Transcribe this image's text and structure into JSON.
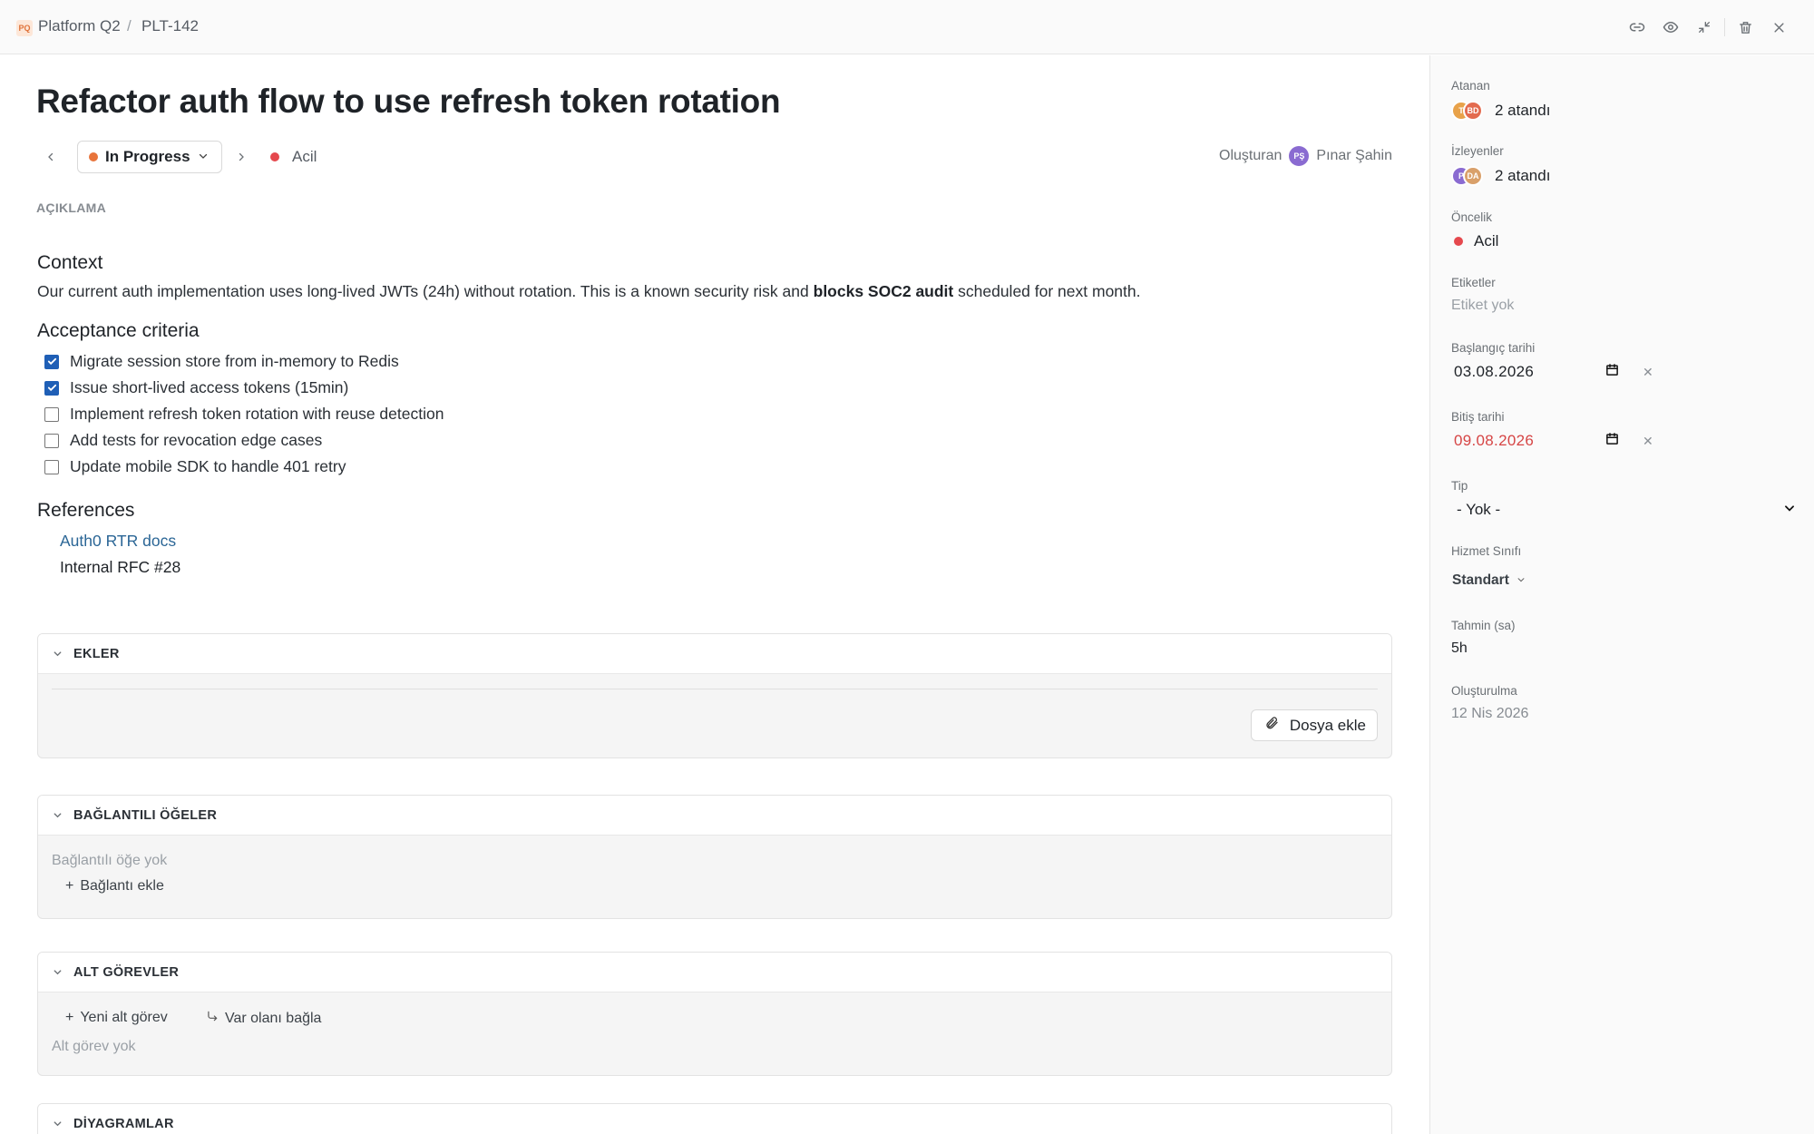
{
  "breadcrumb": {
    "project_badge": "PQ",
    "project": "Platform Q2",
    "separator": "/",
    "issue_key": "PLT-142"
  },
  "toolbar_icons": [
    "link-icon",
    "eye-icon",
    "collapse-icon",
    "trash-icon",
    "close-icon"
  ],
  "issue": {
    "title": "Refactor auth flow to use refresh token rotation",
    "status": "In Progress",
    "status_color": "#e8743b",
    "priority": "Acil",
    "priority_color": "#e5484d",
    "created_by_label": "Oluşturan",
    "creator_initials": "PŞ",
    "creator_name": "Pınar Şahin",
    "creator_color": "#8a6bd1"
  },
  "description": {
    "label": "AÇIKLAMA",
    "context_heading": "Context",
    "context_text_1": "Our current auth implementation uses long-lived JWTs (24h) without rotation. This is a known security risk and",
    "context_bold": "blocks SOC2 audit",
    "context_text_2": "scheduled for next month.",
    "criteria_heading": "Acceptance criteria",
    "criteria": [
      {
        "text": "Migrate session store from in-memory to Redis",
        "checked": true
      },
      {
        "text": "Issue short-lived access tokens (15min)",
        "checked": true
      },
      {
        "text": "Implement refresh token rotation with reuse detection",
        "checked": false
      },
      {
        "text": "Add tests for revocation edge cases",
        "checked": false
      },
      {
        "text": "Update mobile SDK to handle 401 retry",
        "checked": false
      }
    ],
    "references_heading": "References",
    "references": [
      {
        "text": "Auth0 RTR docs",
        "link": true
      },
      {
        "text": "Internal RFC #28",
        "link": false
      }
    ]
  },
  "attachments": {
    "title": "EKLER",
    "add_button": "Dosya ekle"
  },
  "linked_items": {
    "title": "BAĞLANTILI ÖĞELER",
    "empty": "Bağlantılı öğe yok",
    "add": "Bağlantı ekle"
  },
  "subtasks": {
    "title": "ALT GÖREVLER",
    "new": "Yeni alt görev",
    "link_existing": "Var olanı bağla",
    "empty": "Alt görev yok"
  },
  "diagrams": {
    "title": "DİYAGRAMLAR"
  },
  "sidebar": {
    "assignees": {
      "label": "Atanan",
      "value": "2 atandı",
      "avatars": [
        {
          "initials": "T",
          "color": "#e8a24a"
        },
        {
          "initials": "BD",
          "color": "#e36b4f"
        }
      ]
    },
    "watchers": {
      "label": "İzleyenler",
      "value": "2 atandı",
      "avatars": [
        {
          "initials": "P",
          "color": "#8a6bd1"
        },
        {
          "initials": "DA",
          "color": "#d9a06a"
        }
      ]
    },
    "priority": {
      "label": "Öncelik",
      "value": "Acil",
      "color": "#e5484d"
    },
    "labels": {
      "label": "Etiketler",
      "value": "Etiket yok"
    },
    "start_date": {
      "label": "Başlangıç tarihi",
      "value": "03.08.2026"
    },
    "due_date": {
      "label": "Bitiş tarihi",
      "value": "09.08.2026",
      "color": "#d64545"
    },
    "type": {
      "label": "Tip",
      "value": "- Yok -"
    },
    "service_class": {
      "label": "Hizmet Sınıfı",
      "value": "Standart"
    },
    "estimate": {
      "label": "Tahmin (sa)",
      "value": "5h"
    },
    "created": {
      "label": "Oluşturulma",
      "value": "12 Nis 2026"
    }
  }
}
